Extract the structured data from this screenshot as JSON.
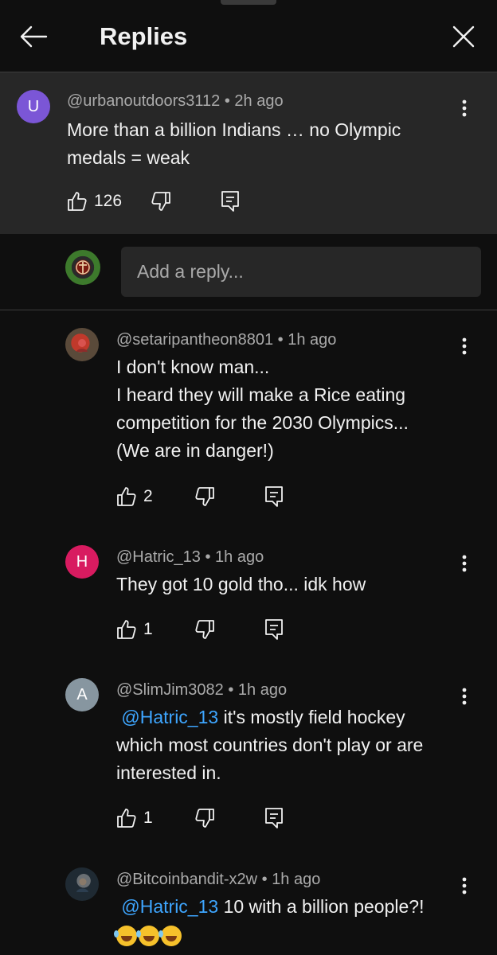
{
  "header": {
    "title": "Replies"
  },
  "parent_comment": {
    "avatar_letter": "U",
    "avatar_color": "#7b56d6",
    "author": "@urbanoutdoors3112",
    "time": "2h ago",
    "text": "More than a billion Indians … no Olympic medals = weak",
    "likes": "126"
  },
  "reply_box": {
    "placeholder": "Add a reply..."
  },
  "replies": [
    {
      "author": "@setaripantheon8801",
      "time": "1h ago",
      "lines": [
        "I don't know man...",
        "I heard they will make a Rice eating competition for the 2030 Olympics...",
        "(We are in danger!)"
      ],
      "likes": "2"
    },
    {
      "avatar_letter": "H",
      "avatar_color": "#d81b60",
      "author": "@Hatric_13",
      "time": "1h ago",
      "text": "They got 10 gold tho... idk how",
      "likes": "1"
    },
    {
      "avatar_letter": "A",
      "avatar_color": "#8796a0",
      "author": "@SlimJim3082",
      "time": "1h ago",
      "mention": "@Hatric_13",
      "text": " it's mostly field hockey which most countries don't play or are interested in.",
      "likes": "1"
    },
    {
      "author": "@Bitcoinbandit-x2w",
      "time": "1h ago",
      "mention": "@Hatric_13",
      "text": "  10 with a billion people?!",
      "emoji_name": "rolling-on-floor-laughing-emoji"
    }
  ]
}
